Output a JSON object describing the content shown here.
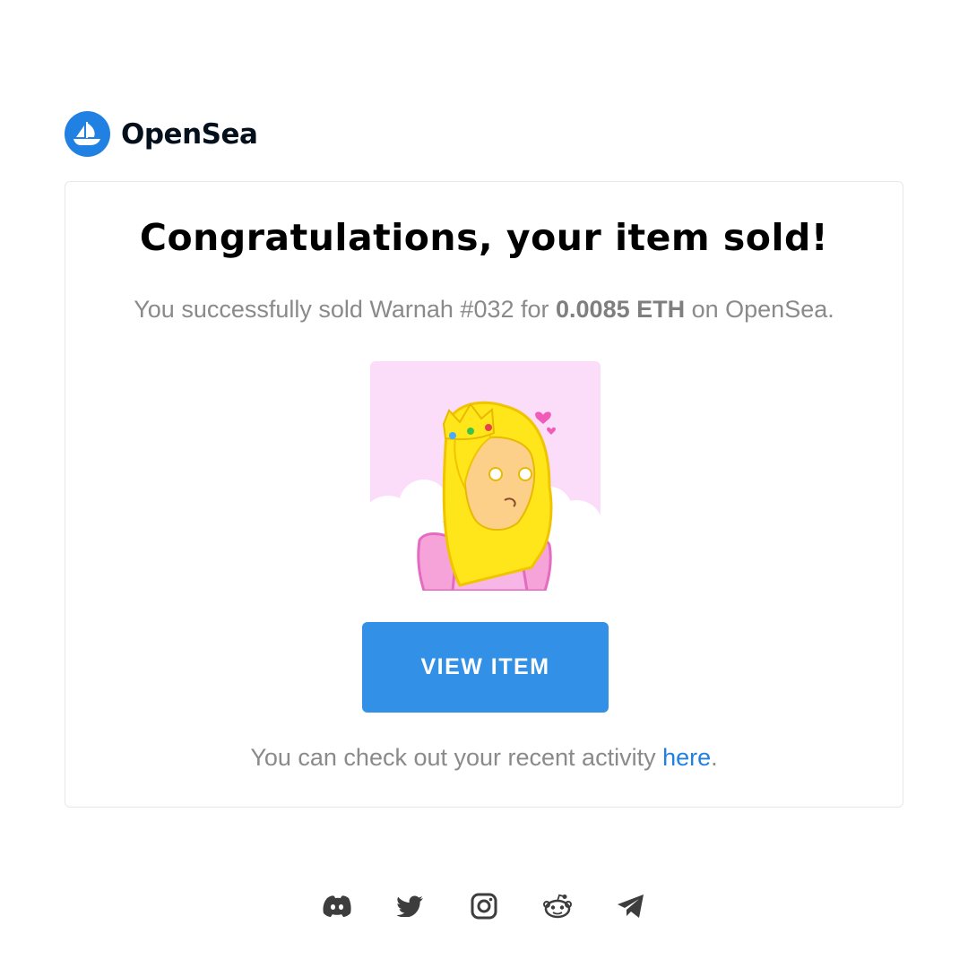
{
  "brand": {
    "name": "OpenSea",
    "color": "#2081E2",
    "logo_icon": "opensea-ship-icon"
  },
  "card": {
    "title": "Congratulations, your item sold!",
    "sold": {
      "prefix": "You successfully sold Warnah #032 for ",
      "price": "0.0085 ETH",
      "suffix": " on OpenSea."
    },
    "nft_image": {
      "alt": "Warnah #032",
      "background": "#FBDCF9"
    },
    "view_button": {
      "label": "VIEW ITEM",
      "color": "#3291E6"
    },
    "activity": {
      "prefix": "You can check out your recent activity ",
      "link_text": "here",
      "suffix": "."
    }
  },
  "social": [
    {
      "name": "Discord",
      "icon": "discord-icon"
    },
    {
      "name": "Twitter",
      "icon": "twitter-icon"
    },
    {
      "name": "Instagram",
      "icon": "instagram-icon"
    },
    {
      "name": "Reddit",
      "icon": "reddit-icon"
    },
    {
      "name": "Telegram",
      "icon": "telegram-icon"
    }
  ]
}
